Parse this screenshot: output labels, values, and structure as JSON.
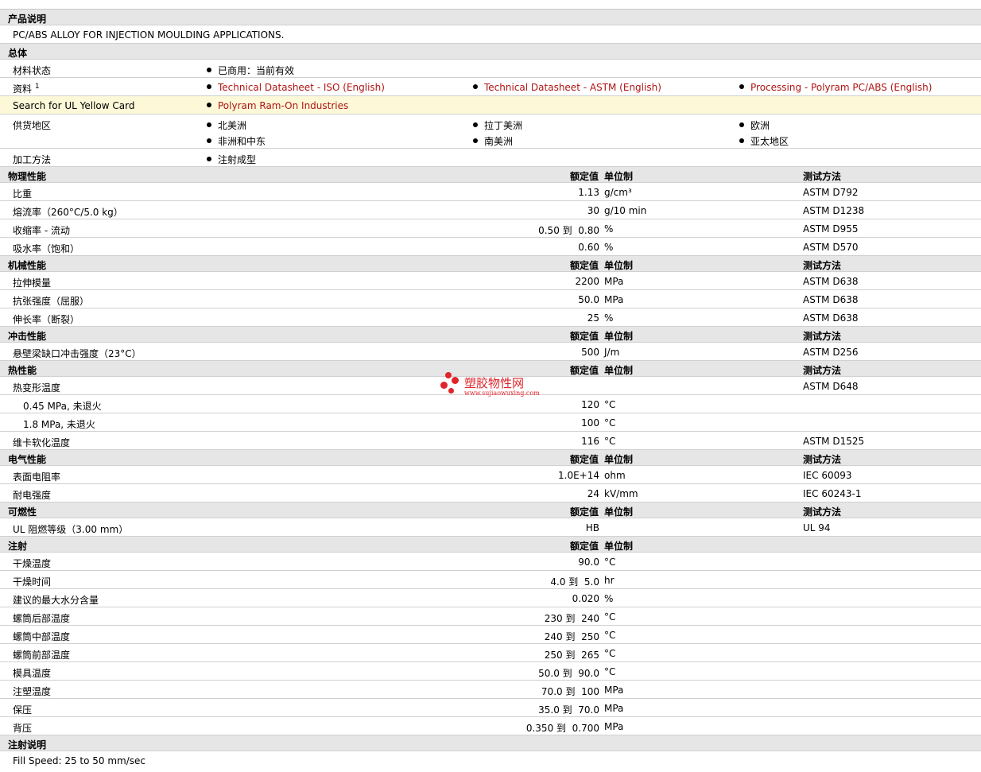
{
  "desc": {
    "title": "产品说明",
    "text": "PC/ABS ALLOY FOR INJECTION MOULDING APPLICATIONS."
  },
  "general": {
    "title": "总体",
    "status_label": "材料状态",
    "status_value": "已商用：当前有效",
    "docs_label": "资料",
    "docs_sup": "1",
    "docs": [
      "Technical Datasheet - ISO (English)",
      "Technical Datasheet - ASTM (English)",
      "Processing - Polyram PC/ABS (English)"
    ],
    "ul_label": "Search for UL Yellow Card",
    "ul_link": "Polyram Ram-On Industries",
    "region_label": "供货地区",
    "regions": [
      "北美洲",
      "拉丁美洲",
      "欧洲",
      "非洲和中东",
      "南美洲",
      "亚太地区"
    ],
    "process_label": "加工方法",
    "process_value": "注射成型"
  },
  "headers": {
    "value": "额定值",
    "unit": "单位制",
    "test": "测试方法"
  },
  "sections": {
    "physical": {
      "title": "物理性能",
      "rows": [
        {
          "label": "比重",
          "value": "1.13",
          "unit": "g/cm³",
          "test": "ASTM D792"
        },
        {
          "label": "熔流率（260°C/5.0 kg）",
          "value": "30",
          "unit": "g/10 min",
          "test": "ASTM D1238"
        },
        {
          "label": "收缩率 - 流动",
          "value": "0.50 到  0.80",
          "unit": "%",
          "test": "ASTM D955"
        },
        {
          "label": "吸水率（饱和）",
          "value": "0.60",
          "unit": "%",
          "test": "ASTM D570"
        }
      ]
    },
    "mechanical": {
      "title": "机械性能",
      "rows": [
        {
          "label": "拉伸模量",
          "value": "2200",
          "unit": "MPa",
          "test": "ASTM D638"
        },
        {
          "label": "抗张强度（屈服）",
          "value": "50.0",
          "unit": "MPa",
          "test": "ASTM D638"
        },
        {
          "label": "伸长率（断裂）",
          "value": "25",
          "unit": "%",
          "test": "ASTM D638"
        }
      ]
    },
    "impact": {
      "title": "冲击性能",
      "rows": [
        {
          "label": "悬壁梁缺口冲击强度（23°C）",
          "value": "500",
          "unit": "J/m",
          "test": "ASTM D256"
        }
      ]
    },
    "thermal": {
      "title": "热性能",
      "rows": [
        {
          "label": "热变形温度",
          "value": "",
          "unit": "",
          "test": "ASTM D648"
        },
        {
          "label": "0.45 MPa, 未退火",
          "value": "120",
          "unit": "°C",
          "test": ""
        },
        {
          "label": "1.8 MPa, 未退火",
          "value": "100",
          "unit": "°C",
          "test": ""
        },
        {
          "label": "维卡软化温度",
          "value": "116",
          "unit": "°C",
          "test": "ASTM D1525"
        }
      ]
    },
    "electrical": {
      "title": "电气性能",
      "rows": [
        {
          "label": "表面电阻率",
          "value": "1.0E+14",
          "unit": "ohm",
          "test": "IEC 60093"
        },
        {
          "label": "耐电强度",
          "value": "24",
          "unit": "kV/mm",
          "test": "IEC 60243-1"
        }
      ]
    },
    "flammability": {
      "title": "可燃性",
      "rows": [
        {
          "label": "UL 阻燃等级（3.00 mm）",
          "value": "HB",
          "unit": "",
          "test": "UL 94"
        }
      ]
    },
    "injection": {
      "title": "注射",
      "rows": [
        {
          "label": "干燥温度",
          "value": "90.0",
          "unit": "°C",
          "test": ""
        },
        {
          "label": "干燥时间",
          "value": "4.0 到  5.0",
          "unit": "hr",
          "test": ""
        },
        {
          "label": "建议的最大水分含量",
          "value": "0.020",
          "unit": "%",
          "test": ""
        },
        {
          "label": "螺筒后部温度",
          "value": "230 到  240",
          "unit": "°C",
          "test": ""
        },
        {
          "label": "螺筒中部温度",
          "value": "240 到  250",
          "unit": "°C",
          "test": ""
        },
        {
          "label": "螺筒前部温度",
          "value": "250 到  265",
          "unit": "°C",
          "test": ""
        },
        {
          "label": "模具温度",
          "value": "50.0 到  90.0",
          "unit": "°C",
          "test": ""
        },
        {
          "label": "注塑温度",
          "value": "70.0 到  100",
          "unit": "MPa",
          "test": ""
        },
        {
          "label": "保压",
          "value": "35.0 到  70.0",
          "unit": "MPa",
          "test": ""
        },
        {
          "label": "背压",
          "value": "0.350 到  0.700",
          "unit": "MPa",
          "test": ""
        }
      ]
    }
  },
  "notes": {
    "title": "注射说明",
    "text": "Fill Speed: 25 to 50 mm/sec"
  },
  "watermark": {
    "title": "塑胶物性网",
    "url": "www.sujiaowuxing.com"
  }
}
